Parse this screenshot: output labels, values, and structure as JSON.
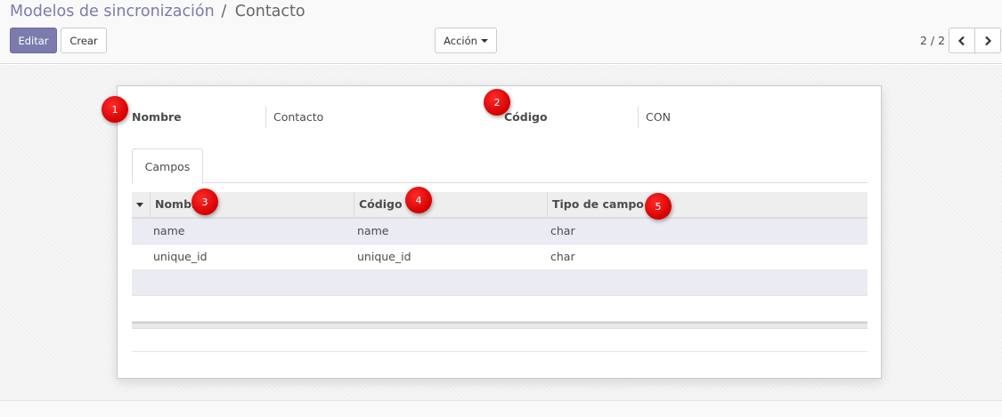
{
  "breadcrumb": {
    "parent": "Modelos de sincronización",
    "separator": "/",
    "current": "Contacto"
  },
  "toolbar": {
    "edit_label": "Editar",
    "create_label": "Crear",
    "action_label": "Acción"
  },
  "pager": {
    "value": "2 / 2"
  },
  "form": {
    "name_label": "Nombre",
    "name_value": "Contacto",
    "code_label": "Código",
    "code_value": "CON"
  },
  "tabs": [
    {
      "label": "Campos"
    }
  ],
  "grid": {
    "columns": [
      "Nombre",
      "Código",
      "Tipo de campo"
    ],
    "rows": [
      {
        "name": "name",
        "code": "name",
        "type": "char"
      },
      {
        "name": "unique_id",
        "code": "unique_id",
        "type": "char"
      }
    ]
  },
  "annotations": [
    "1",
    "2",
    "3",
    "4",
    "5"
  ],
  "colors": {
    "primary": "#7c7bad",
    "badge": "#e00000"
  },
  "icons": {
    "prev": "chevron-left-icon",
    "next": "chevron-right-icon",
    "dropdown": "caret-down-icon"
  }
}
